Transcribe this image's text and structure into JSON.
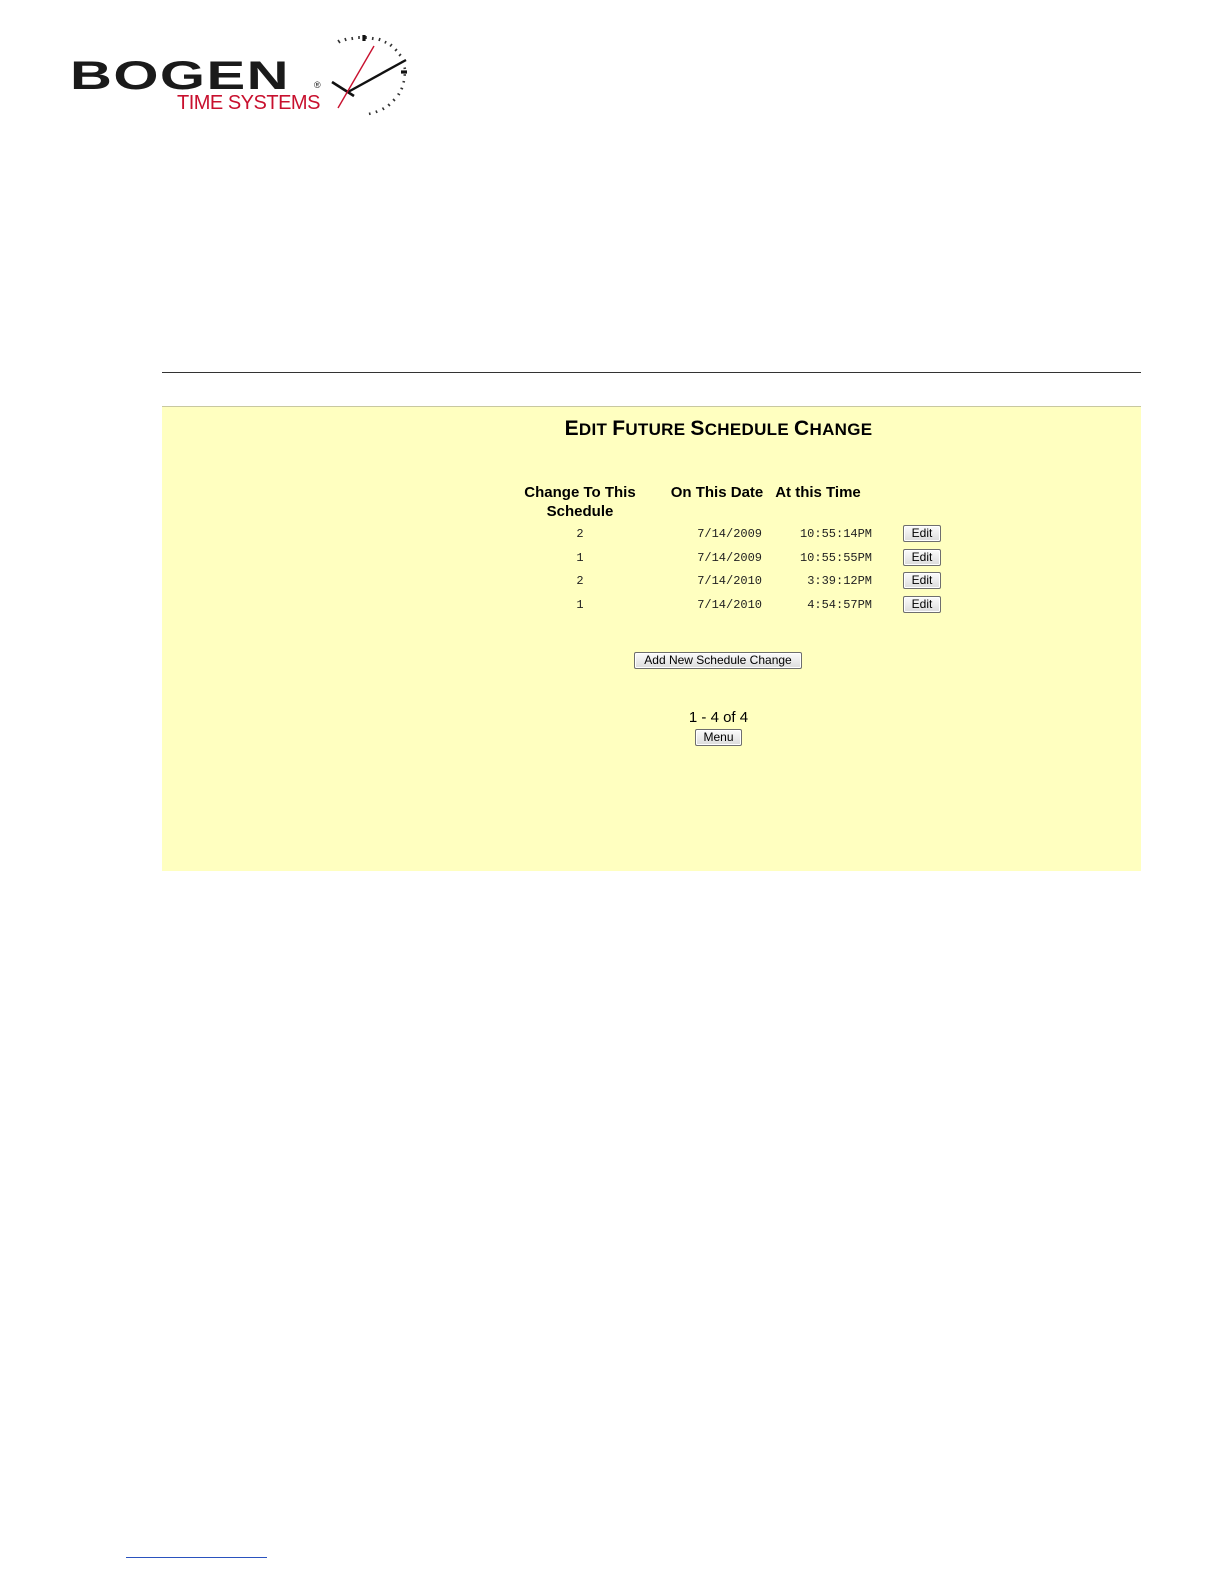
{
  "logo": {
    "brand": "BOGEN",
    "registered": "®",
    "tagline": "TIME SYSTEMS",
    "icon": "clock-icon",
    "brand_color": "#1a1a1a",
    "accent_color": "#c8102e"
  },
  "page": {
    "title_first": "E",
    "title_rest1": "DIT ",
    "title_f": "F",
    "title_rest2": "UTURE ",
    "title_s": "S",
    "title_rest3": "CHEDULE ",
    "title_c": "C",
    "title_rest4": "HANGE",
    "panel_color": "#ffffc0"
  },
  "table": {
    "headers": {
      "schedule": "Change To This Schedule",
      "date": "On This Date",
      "time": "At this Time"
    },
    "rows": [
      {
        "schedule": "2",
        "date": "7/14/2009",
        "time": "10:55:14PM",
        "action": "Edit"
      },
      {
        "schedule": "1",
        "date": "7/14/2009",
        "time": "10:55:55PM",
        "action": "Edit"
      },
      {
        "schedule": "2",
        "date": "7/14/2010",
        "time": "3:39:12PM",
        "action": "Edit"
      },
      {
        "schedule": "1",
        "date": "7/14/2010",
        "time": "4:54:57PM",
        "action": "Edit"
      }
    ]
  },
  "actions": {
    "add_label": "Add New Schedule Change",
    "pager_text": "1 - 4 of 4",
    "menu_label": "Menu"
  }
}
